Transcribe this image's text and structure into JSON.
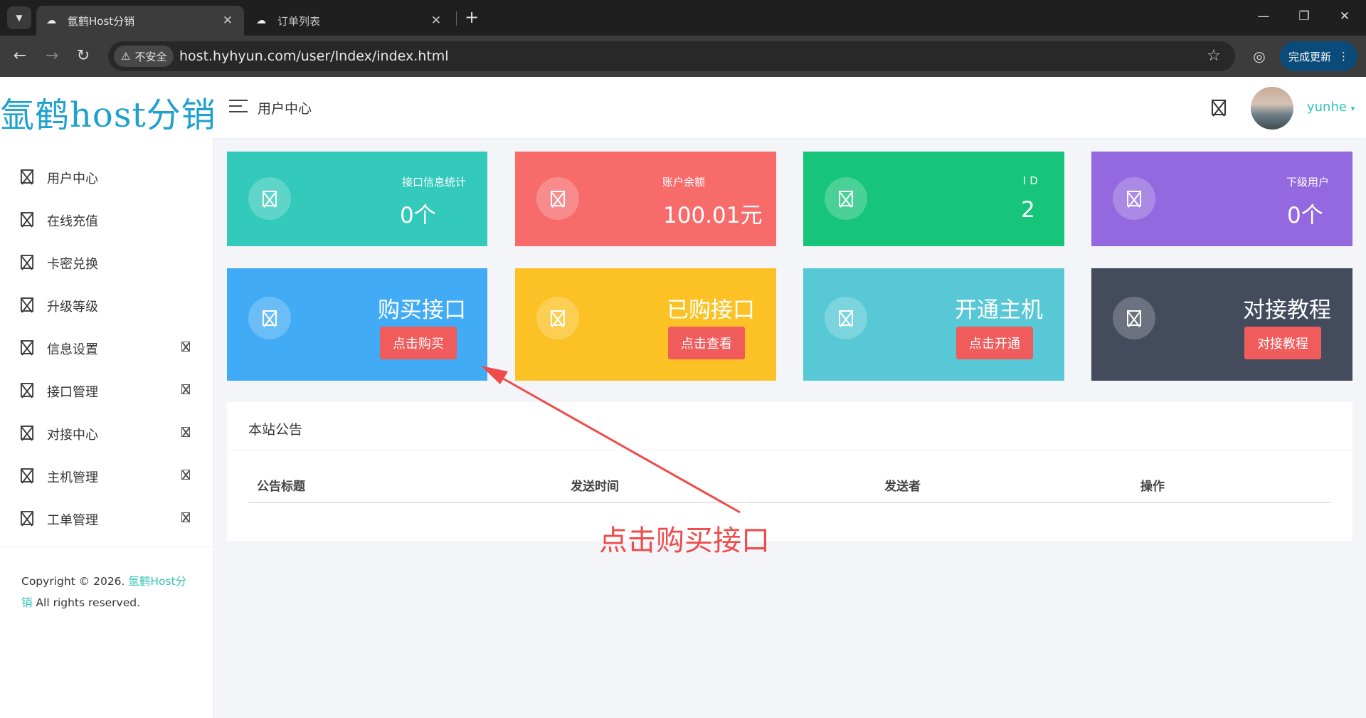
{
  "browser": {
    "tabs": [
      {
        "title": "氩鹤Host分销",
        "active": true,
        "favicon": "cloud-icon"
      },
      {
        "title": "订单列表",
        "active": false,
        "favicon": "cloud-icon"
      }
    ],
    "security_label": "不安全",
    "url": "host.hyhyun.com/user/Index/index.html",
    "update_label": "完成更新"
  },
  "header": {
    "logo_text": "氩鹤host分销",
    "title": "用户中心",
    "username": "yunhe"
  },
  "sidebar": {
    "items": [
      {
        "label": "用户中心",
        "has_arrow": false
      },
      {
        "label": "在线充值",
        "has_arrow": false
      },
      {
        "label": "卡密兑换",
        "has_arrow": false
      },
      {
        "label": "升级等级",
        "has_arrow": false
      },
      {
        "label": "信息设置",
        "has_arrow": true
      },
      {
        "label": "接口管理",
        "has_arrow": true
      },
      {
        "label": "对接中心",
        "has_arrow": true
      },
      {
        "label": "主机管理",
        "has_arrow": true
      },
      {
        "label": "工单管理",
        "has_arrow": true
      }
    ],
    "copyright_prefix": "Copyright © 2026. ",
    "copyright_link": "氩鹤Host分销",
    "copyright_suffix": " All rights reserved."
  },
  "stats": [
    {
      "label": "接口信息统计",
      "value": "0个",
      "color": "#33c9bb"
    },
    {
      "label": "账户余额",
      "value": "100.01元",
      "color": "#f76b6b"
    },
    {
      "label": "I D",
      "value": "2",
      "color": "#16c47a"
    },
    {
      "label": "下级用户",
      "value": "0个",
      "color": "#9469df"
    }
  ],
  "actions": [
    {
      "title": "购买接口",
      "button": "点击购买",
      "color": "#42abf5"
    },
    {
      "title": "已购接口",
      "button": "点击查看",
      "color": "#fcc225"
    },
    {
      "title": "开通主机",
      "button": "点击开通",
      "color": "#58c8d6"
    },
    {
      "title": "对接教程",
      "button": "对接教程",
      "color": "#434b5c"
    }
  ],
  "notice": {
    "title": "本站公告",
    "columns": [
      "公告标题",
      "发送时间",
      "发送者",
      "操作"
    ]
  },
  "annotation": {
    "text": "点击购买接口",
    "color": "#ef4b4b"
  }
}
